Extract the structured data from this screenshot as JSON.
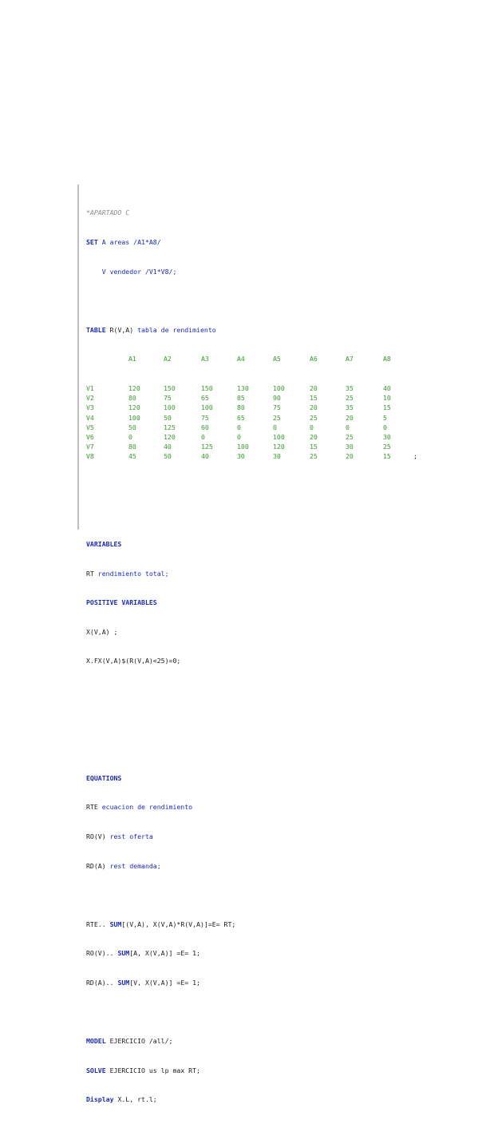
{
  "code": {
    "comment_line": "*APARTADO C",
    "set_kw": "SET",
    "set_rest": " A areas /A1*A8/",
    "set_line2": "    V vendedor /V1*V8/;",
    "table_kw": "TABLE",
    "table_name": " R(V,A) ",
    "table_desc": "tabla de rendimiento",
    "table_headers": [
      "A1",
      "A2",
      "A3",
      "A4",
      "A5",
      "A6",
      "A7",
      "A8"
    ],
    "table_rows": [
      {
        "label": "V1",
        "values": [
          "120",
          "150",
          "150",
          "130",
          "100",
          "20",
          "35",
          "40"
        ],
        "end": ""
      },
      {
        "label": "V2",
        "values": [
          "80",
          "75",
          "65",
          "85",
          "90",
          "15",
          "25",
          "10"
        ],
        "end": ""
      },
      {
        "label": "V3",
        "values": [
          "120",
          "100",
          "100",
          "80",
          "75",
          "20",
          "35",
          "15"
        ],
        "end": ""
      },
      {
        "label": "V4",
        "values": [
          "100",
          "50",
          "75",
          "65",
          "25",
          "25",
          "20",
          "5"
        ],
        "end": ""
      },
      {
        "label": "V5",
        "values": [
          "50",
          "125",
          "60",
          "0",
          "0",
          "0",
          "0",
          "0"
        ],
        "end": ""
      },
      {
        "label": "V6",
        "values": [
          "0",
          "120",
          "0",
          "0",
          "100",
          "20",
          "25",
          "30"
        ],
        "end": ""
      },
      {
        "label": "V7",
        "values": [
          "80",
          "40",
          "125",
          "100",
          "120",
          "15",
          "30",
          "25"
        ],
        "end": ""
      },
      {
        "label": "V8",
        "values": [
          "45",
          "50",
          "40",
          "30",
          "30",
          "25",
          "20",
          "15"
        ],
        "end": ";"
      }
    ],
    "variables_kw": "VARIABLES",
    "rt_name": "RT ",
    "rt_desc": "rendimiento total;",
    "positive_kw": "POSITIVE VARIABLES",
    "x_decl": "X(V,A) ;",
    "x_fx": "X.FX(V,A)$(R(V,A)<25)=0;",
    "equations_kw": "EQUATIONS",
    "eq1_name": "RTE ",
    "eq1_desc": "ecuacion de rendimiento",
    "eq2_name": "RO(V) ",
    "eq2_desc": "rest oferta",
    "eq3_name": "RD(A) ",
    "eq3_desc": "rest demanda;",
    "def1_a": "RTE.. ",
    "def1_kw": "SUM",
    "def1_b": "[(V,A), X(V,A)*R(V,A)]=E= RT;",
    "def2_a": "RO(V).. ",
    "def2_kw": "SUM",
    "def2_b": "[A, X(V,A)] =E= 1;",
    "def3_a": "RD(A).. ",
    "def3_kw": "SUM",
    "def3_b": "[V, X(V,A)] =E= 1;",
    "model_kw": "MODEL",
    "model_rest": " EJERCICIO /all/;",
    "solve_kw": "SOLVE",
    "solve_rest": " EJERCICIO us lp max RT;",
    "display_kw": "Display",
    "display_rest": " X.L, rt.l;"
  },
  "colors": {
    "keyword": "#1c2ab8",
    "data": "#3a9a2e",
    "comment": "#8a8a8a",
    "text": "#1a1a1a"
  }
}
